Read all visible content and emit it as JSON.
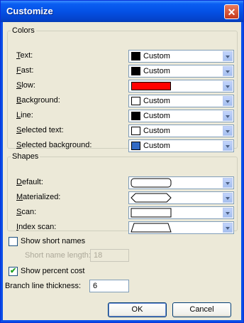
{
  "window": {
    "title": "Customize",
    "close_label": "✕"
  },
  "colors": {
    "legend": "Colors",
    "rows": [
      {
        "label_u": "T",
        "label_rest": "ext:",
        "value": "Custom",
        "swatch": "#000000"
      },
      {
        "label_u": "F",
        "label_rest": "ast:",
        "value": "Custom",
        "swatch": "#000000"
      },
      {
        "label_u": "S",
        "label_rest": "low:",
        "value": "",
        "swatch": "#ff0000"
      },
      {
        "label_u": "B",
        "label_rest": "ackground:",
        "value": "Custom",
        "swatch": "#ffffff"
      },
      {
        "label_u": "L",
        "label_rest": "ine:",
        "value": "Custom",
        "swatch": "#000000"
      },
      {
        "label_u": "S",
        "label_rest": "elected text:",
        "value": "Custom",
        "swatch": "#ffffff"
      },
      {
        "label_u": "S",
        "label_rest": "elected background:",
        "value": "Custom",
        "swatch": "#316ac5"
      }
    ]
  },
  "shapes": {
    "legend": "Shapes",
    "rows": [
      {
        "label_u": "D",
        "label_rest": "efault:",
        "shape": "rounded-rectangle"
      },
      {
        "label_u": "M",
        "label_rest": "aterialized:",
        "shape": "hexagon"
      },
      {
        "label_u": "S",
        "label_rest": "can:",
        "shape": "rectangle"
      },
      {
        "label_u": "I",
        "label_rest": "ndex scan:",
        "shape": "trapezoid"
      }
    ]
  },
  "options": {
    "show_short_names": {
      "label": "Show short names",
      "checked": false
    },
    "short_name_length": {
      "label": "Short name length:",
      "value": "18",
      "disabled": true
    },
    "show_percent_cost": {
      "label": "Show percent cost",
      "checked": true
    },
    "branch_line_thickness": {
      "label": "Branch line thickness:",
      "value": "6"
    }
  },
  "buttons": {
    "ok": "OK",
    "cancel": "Cancel"
  }
}
